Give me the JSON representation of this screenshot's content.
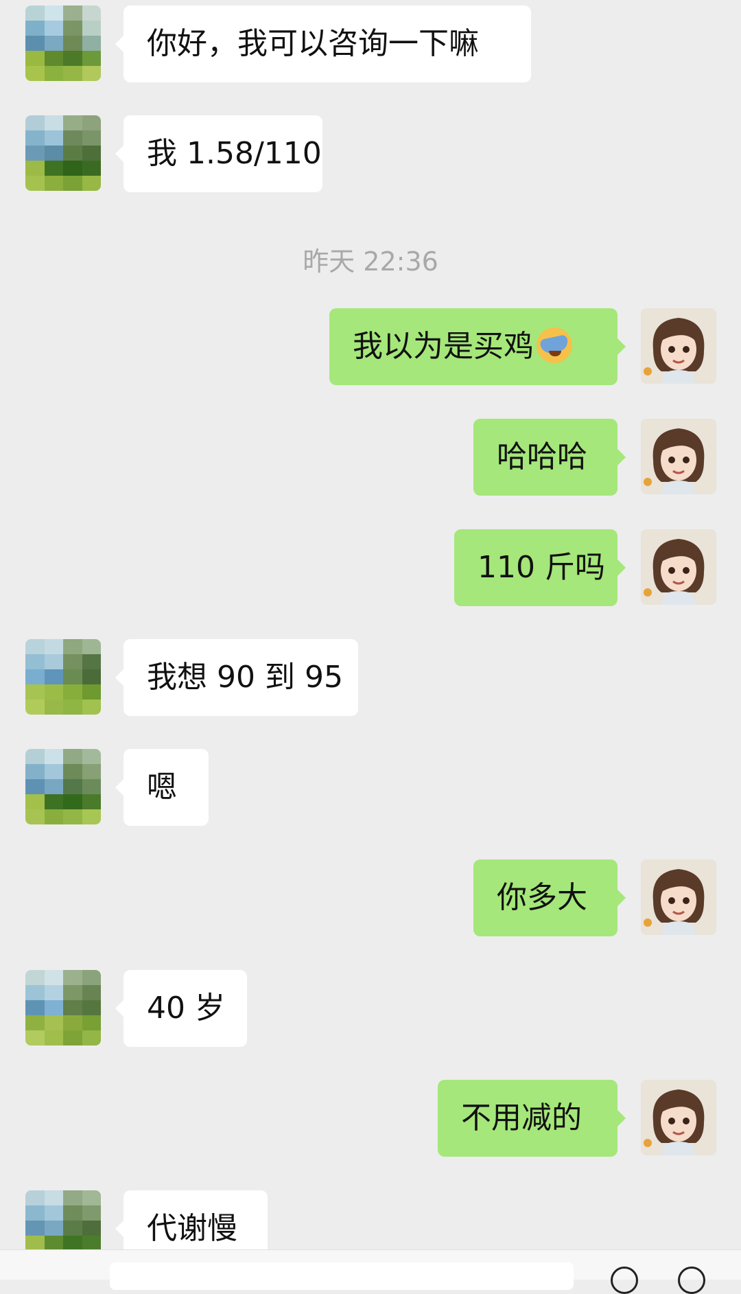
{
  "timestamp": "昨天 22:36",
  "messages": [
    {
      "side": "in",
      "text": "你好，我可以咨询一下嘛"
    },
    {
      "side": "in",
      "text": "我 1.58/110"
    },
    {
      "side": "out",
      "text": "我以为是买鸡"
    },
    {
      "side": "out",
      "text": "哈哈哈"
    },
    {
      "side": "out",
      "text": "110 斤吗"
    },
    {
      "side": "in",
      "text": "我想 90 到 95"
    },
    {
      "side": "in",
      "text": "嗯"
    },
    {
      "side": "out",
      "text": "你多大"
    },
    {
      "side": "in",
      "text": "40 岁"
    },
    {
      "side": "out",
      "text": "不用减的"
    },
    {
      "side": "in",
      "text": "代谢慢"
    }
  ],
  "icons": {
    "emoji": "facepalm-emoji-icon",
    "incoming_avatar": "pixelated-avatar",
    "outgoing_avatar": "cartoon-girl-avatar"
  },
  "colors": {
    "background": "#ededed",
    "incoming_bubble": "#ffffff",
    "outgoing_bubble": "#a5e77a",
    "timestamp": "#a8a8a8"
  }
}
